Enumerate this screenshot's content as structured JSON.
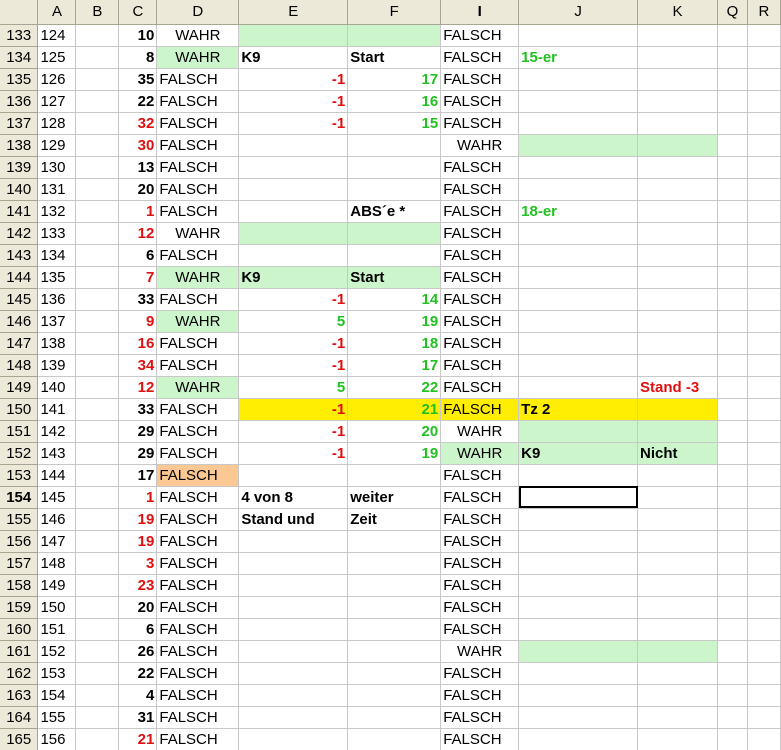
{
  "columns": [
    "A",
    "B",
    "C",
    "D",
    "E",
    "F",
    "I",
    "J",
    "K",
    "Q",
    "R"
  ],
  "rows": [
    {
      "r": "133",
      "a": "124",
      "c": "10",
      "c_color": "black",
      "d": "WAHR",
      "d_bg": "",
      "e": "",
      "f": "",
      "i": "FALSCH",
      "j": "",
      "k": "",
      "hl": "green_EF"
    },
    {
      "r": "134",
      "a": "125",
      "c": "8",
      "c_color": "black",
      "d": "WAHR",
      "d_bg": "green",
      "e": "K9",
      "e_style": "bold",
      "f": "Start",
      "f_style": "bold",
      "i": "FALSCH",
      "j": "15-er",
      "j_style": "bold-green",
      "k": ""
    },
    {
      "r": "135",
      "a": "126",
      "c": "35",
      "c_color": "black",
      "d": "FALSCH",
      "e": "-1",
      "e_style": "num-red",
      "f": "17",
      "f_style": "num-green",
      "i": "FALSCH",
      "j": "",
      "k": ""
    },
    {
      "r": "136",
      "a": "127",
      "c": "22",
      "c_color": "black",
      "d": "FALSCH",
      "e": "-1",
      "e_style": "num-red",
      "f": "16",
      "f_style": "num-green",
      "i": "FALSCH",
      "j": "",
      "k": ""
    },
    {
      "r": "137",
      "a": "128",
      "c": "32",
      "c_color": "red",
      "d": "FALSCH",
      "e": "-1",
      "e_style": "num-red",
      "f": "15",
      "f_style": "num-green",
      "i": "FALSCH",
      "j": "",
      "k": ""
    },
    {
      "r": "138",
      "a": "129",
      "c": "30",
      "c_color": "red",
      "d": "FALSCH",
      "e": "",
      "f": "",
      "i": "WAHR",
      "i_center": true,
      "j": "",
      "k": "",
      "hl": "green_JK"
    },
    {
      "r": "139",
      "a": "130",
      "c": "13",
      "c_color": "black",
      "d": "FALSCH",
      "e": "",
      "f": "",
      "i": "FALSCH",
      "j": "",
      "k": ""
    },
    {
      "r": "140",
      "a": "131",
      "c": "20",
      "c_color": "black",
      "d": "FALSCH",
      "e": "",
      "f": "",
      "i": "FALSCH",
      "j": "",
      "k": ""
    },
    {
      "r": "141",
      "a": "132",
      "c": "1",
      "c_color": "red",
      "d": "FALSCH",
      "e": "",
      "f": "ABS´e *",
      "f_style": "bold",
      "i": "FALSCH",
      "j": "18-er",
      "j_style": "bold-green",
      "k": ""
    },
    {
      "r": "142",
      "a": "133",
      "c": "12",
      "c_color": "red",
      "d": "WAHR",
      "e": "",
      "f": "",
      "i": "FALSCH",
      "j": "",
      "k": "",
      "hl": "green_EF"
    },
    {
      "r": "143",
      "a": "134",
      "c": "6",
      "c_color": "black",
      "d": "FALSCH",
      "e": "",
      "f": "",
      "i": "FALSCH",
      "j": "",
      "k": ""
    },
    {
      "r": "144",
      "a": "135",
      "c": "7",
      "c_color": "red",
      "d": "WAHR",
      "d_bg": "green",
      "e": "K9",
      "e_style": "bold",
      "f": "Start",
      "f_style": "bold",
      "i": "FALSCH",
      "j": "",
      "k": "",
      "hl": "green_EF"
    },
    {
      "r": "145",
      "a": "136",
      "c": "33",
      "c_color": "black",
      "d": "FALSCH",
      "e": "-1",
      "e_style": "num-red",
      "f": "14",
      "f_style": "num-green",
      "i": "FALSCH",
      "j": "",
      "k": ""
    },
    {
      "r": "146",
      "a": "137",
      "c": "9",
      "c_color": "red",
      "d": "WAHR",
      "d_bg": "green",
      "e": "5",
      "e_style": "num-green",
      "f": "19",
      "f_style": "num-green",
      "i": "FALSCH",
      "j": "",
      "k": ""
    },
    {
      "r": "147",
      "a": "138",
      "c": "16",
      "c_color": "red",
      "d": "FALSCH",
      "e": "-1",
      "e_style": "num-red",
      "f": "18",
      "f_style": "num-green",
      "i": "FALSCH",
      "j": "",
      "k": ""
    },
    {
      "r": "148",
      "a": "139",
      "c": "34",
      "c_color": "red",
      "d": "FALSCH",
      "e": "-1",
      "e_style": "num-red",
      "f": "17",
      "f_style": "num-green",
      "i": "FALSCH",
      "j": "",
      "k": ""
    },
    {
      "r": "149",
      "a": "140",
      "c": "12",
      "c_color": "red",
      "d": "WAHR",
      "d_bg": "green",
      "e": "5",
      "e_style": "num-green",
      "f": "22",
      "f_style": "num-green",
      "i": "FALSCH",
      "j": "",
      "k": "Stand -3",
      "k_style": "bold-red"
    },
    {
      "r": "150",
      "a": "141",
      "c": "33",
      "c_color": "black",
      "d": "FALSCH",
      "e": "-1",
      "e_style": "num-red",
      "f": "21",
      "f_style": "num-green",
      "i": "FALSCH",
      "j": "Tz 2",
      "j_style": "bold",
      "k": "",
      "hl": "yellow"
    },
    {
      "r": "151",
      "a": "142",
      "c": "29",
      "c_color": "black",
      "d": "FALSCH",
      "e": "-1",
      "e_style": "num-red",
      "f": "20",
      "f_style": "num-green",
      "i": "WAHR",
      "i_center": true,
      "j": "",
      "k": "",
      "hl": "green_JK"
    },
    {
      "r": "152",
      "a": "143",
      "c": "29",
      "c_color": "black",
      "d": "FALSCH",
      "e": "-1",
      "e_style": "num-red",
      "f": "19",
      "f_style": "num-green",
      "i": "WAHR",
      "i_center": true,
      "i_bg": "green",
      "j": "K9",
      "j_style": "bold",
      "k": "Nicht",
      "k_style": "bold",
      "hl": "green_JK"
    },
    {
      "r": "153",
      "a": "144",
      "c": "17",
      "c_color": "black",
      "d": "FALSCH",
      "d_bg": "orange",
      "e": "",
      "f": "",
      "i": "FALSCH",
      "j": "",
      "k": ""
    },
    {
      "r": "154",
      "a": "145",
      "c": "1",
      "c_color": "red",
      "d": "FALSCH",
      "e": "4 von 8",
      "e_style": "bold",
      "f": "weiter",
      "f_style": "bold",
      "i": "FALSCH",
      "j": "",
      "k": "",
      "active": true
    },
    {
      "r": "155",
      "a": "146",
      "c": "19",
      "c_color": "red",
      "d": "FALSCH",
      "e": "Stand und",
      "e_style": "bold",
      "f": "Zeit",
      "f_style": "bold",
      "i": "FALSCH",
      "j": "",
      "k": ""
    },
    {
      "r": "156",
      "a": "147",
      "c": "19",
      "c_color": "red",
      "d": "FALSCH",
      "e": "",
      "f": "",
      "i": "FALSCH",
      "j": "",
      "k": ""
    },
    {
      "r": "157",
      "a": "148",
      "c": "3",
      "c_color": "red",
      "d": "FALSCH",
      "e": "",
      "f": "",
      "i": "FALSCH",
      "j": "",
      "k": ""
    },
    {
      "r": "158",
      "a": "149",
      "c": "23",
      "c_color": "red",
      "d": "FALSCH",
      "e": "",
      "f": "",
      "i": "FALSCH",
      "j": "",
      "k": ""
    },
    {
      "r": "159",
      "a": "150",
      "c": "20",
      "c_color": "black",
      "d": "FALSCH",
      "e": "",
      "f": "",
      "i": "FALSCH",
      "j": "",
      "k": ""
    },
    {
      "r": "160",
      "a": "151",
      "c": "6",
      "c_color": "black",
      "d": "FALSCH",
      "e": "",
      "f": "",
      "i": "FALSCH",
      "j": "",
      "k": ""
    },
    {
      "r": "161",
      "a": "152",
      "c": "26",
      "c_color": "black",
      "d": "FALSCH",
      "e": "",
      "f": "",
      "i": "WAHR",
      "i_center": true,
      "j": "",
      "k": "",
      "hl": "green_JK"
    },
    {
      "r": "162",
      "a": "153",
      "c": "22",
      "c_color": "black",
      "d": "FALSCH",
      "e": "",
      "f": "",
      "i": "FALSCH",
      "j": "",
      "k": ""
    },
    {
      "r": "163",
      "a": "154",
      "c": "4",
      "c_color": "black",
      "d": "FALSCH",
      "e": "",
      "f": "",
      "i": "FALSCH",
      "j": "",
      "k": ""
    },
    {
      "r": "164",
      "a": "155",
      "c": "31",
      "c_color": "black",
      "d": "FALSCH",
      "e": "",
      "f": "",
      "i": "FALSCH",
      "j": "",
      "k": ""
    },
    {
      "r": "165",
      "a": "156",
      "c": "21",
      "c_color": "red",
      "d": "FALSCH",
      "e": "",
      "f": "",
      "i": "FALSCH",
      "j": "",
      "k": ""
    }
  ]
}
